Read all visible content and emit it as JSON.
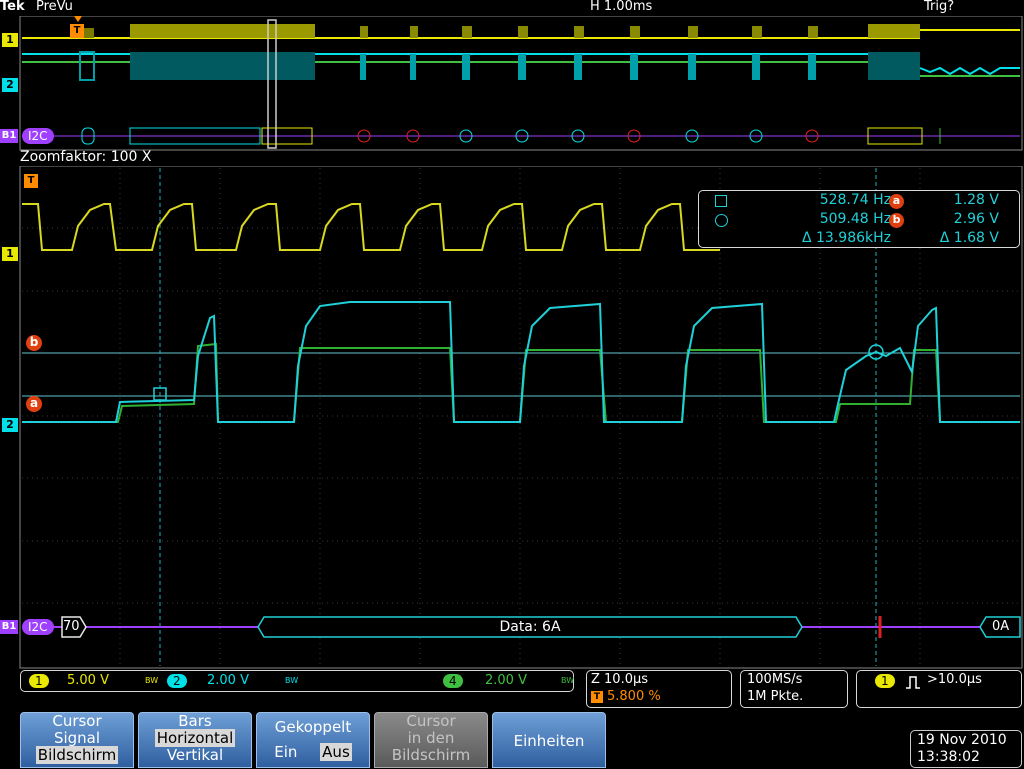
{
  "status_bar": {
    "brand": "Tek",
    "mode": "PreVu",
    "horizontal_scale": "H 1.00ms",
    "trigger_state": "Trig?"
  },
  "zoom": {
    "label": "Zoomfaktor: 100 X"
  },
  "channel_markers": {
    "ch1": "1",
    "ch2": "2",
    "bus": "B1",
    "trigger": "T",
    "cursor_a": "a",
    "cursor_b": "b"
  },
  "overview_bus": {
    "label": "I2C"
  },
  "main_bus": {
    "label": "I2C",
    "address": "70",
    "data_packet": "Data: 6A",
    "end_packet": "0A"
  },
  "cursor_readout": {
    "freq_square": "528.74 Hz",
    "freq_circle": "509.48 Hz",
    "freq_delta": "Δ 13.986kHz",
    "volt_a": "1.28 V",
    "volt_b": "2.96 V",
    "volt_delta": "Δ 1.68 V"
  },
  "vertical_settings": {
    "ch1": {
      "num": "1",
      "value": "5.00 V",
      "bw": "BW",
      "color": "#e8e800"
    },
    "ch2": {
      "num": "2",
      "value": "2.00 V",
      "bw": "BW",
      "color": "#00e0e8"
    },
    "ch4": {
      "num": "4",
      "value": "2.00 V",
      "bw": "BW",
      "color": "#40c040"
    }
  },
  "zoom_settings": {
    "scale": "Z 10.0μs",
    "position": "5.800 %"
  },
  "acquisition": {
    "rate": "100MS/s",
    "points": "1M Pkte."
  },
  "trigger": {
    "source": "1",
    "condition": ">10.0μs"
  },
  "menu": {
    "cursor_title": "Cursor",
    "cursor_opt1": "Signal",
    "cursor_opt2": "Bildschirm",
    "bars_title": "Bars",
    "bars_opt1": "Horizontal",
    "bars_opt2": "Vertikal",
    "coupled_title": "Gekoppelt",
    "coupled_on": "Ein",
    "coupled_off": "Aus",
    "cursor_screen_line1": "Cursor",
    "cursor_screen_line2": "in den",
    "cursor_screen_line3": "Bildschirm",
    "units": "Einheiten"
  },
  "datetime": {
    "date": "19 Nov 2010",
    "time": "13:38:02"
  },
  "colors": {
    "ch1": "#e8e800",
    "ch2": "#00e0e8",
    "ch4": "#40c040",
    "bus": "#a040ff",
    "accent": "#ff8c00",
    "error": "#e02020"
  }
}
